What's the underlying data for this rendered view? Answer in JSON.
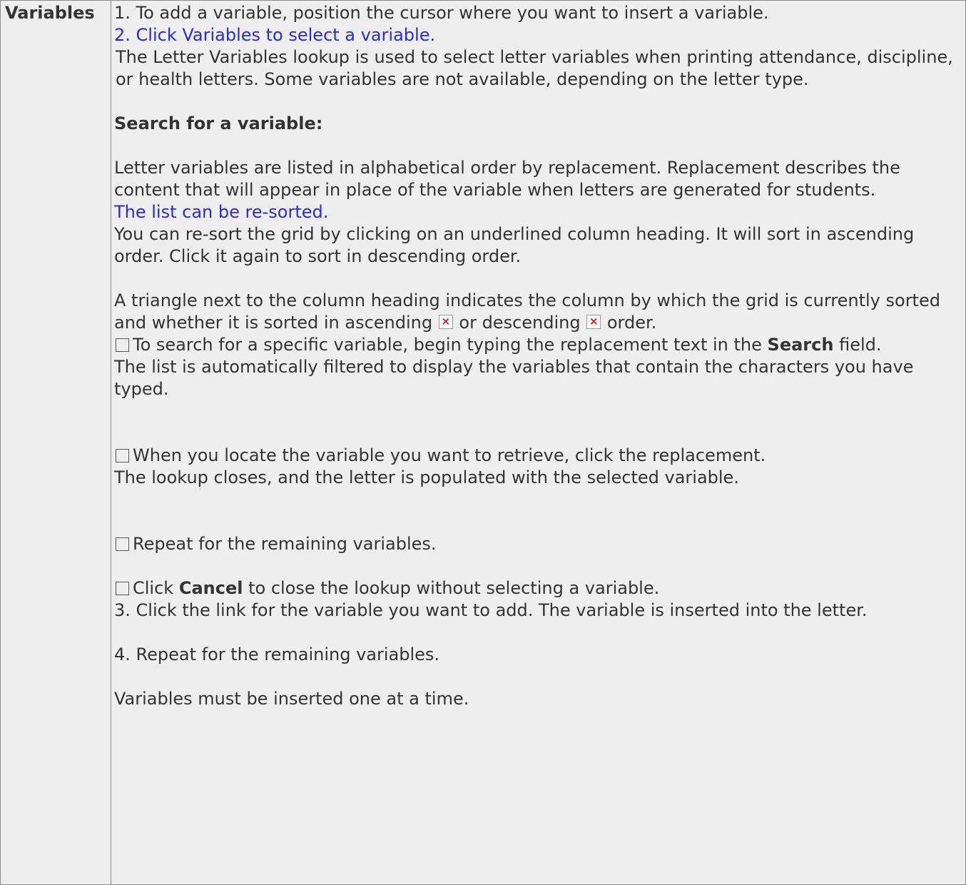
{
  "term": "Variables",
  "steps": {
    "step1": "1. To add a variable, position the cursor where you want to insert a variable.",
    "step2_link": "2. Click Variables to select a variable.",
    "lookup_desc": "The Letter Variables lookup is used to select letter variables when printing attendance, discipline, or health letters. Some variables are not available, depending on the letter type.",
    "search_heading": "Search for a variable:",
    "order_desc": "Letter variables are listed in alphabetical order by replacement. Replacement describes the content that will appear in place of the variable when letters are generated for students.",
    "resort_link": "The list can be re-sorted.",
    "resort_desc": "You can re-sort the grid by clicking on an underlined column heading. It will sort in ascending order. Click it again to sort in descending order.",
    "triangle_a": "A triangle next to the column heading indicates the column by which the grid is currently sorted and whether it is sorted in ascending",
    "triangle_or": "or descending",
    "triangle_b": "order.",
    "search_a": "To search for a specific variable, begin typing the replacement text in the",
    "search_bold": "Search",
    "search_b": "field.",
    "filter_desc": "The list is automatically filtered to display the variables that contain the characters you have typed.",
    "locate": "When you locate the variable you want to retrieve, click the replacement.",
    "lookup_closes": "The lookup closes, and the letter is populated with the selected variable.",
    "repeat_cb": "Repeat for the remaining variables.",
    "cancel_a": "Click",
    "cancel_bold": "Cancel",
    "cancel_b": "to close the lookup without selecting a variable.",
    "step3": "3. Click the link for the variable you want to add. The variable is inserted into the letter.",
    "step4": "4. Repeat for the remaining variables.",
    "note": "Variables must be inserted one at a time."
  },
  "colors": {
    "background": "#eeeeee",
    "text": "#333333",
    "link": "#2b2bd6",
    "border": "#8a8a8a"
  },
  "icons": [
    "broken-image-icon",
    "checkbox-icon"
  ]
}
